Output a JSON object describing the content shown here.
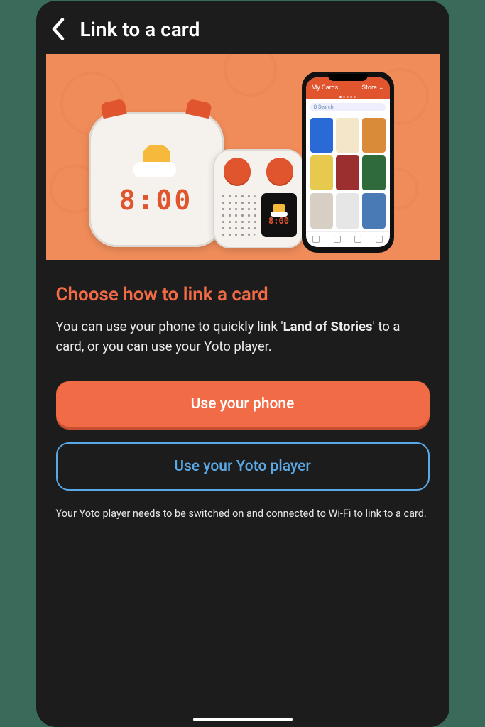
{
  "header": {
    "title": "Link to a card"
  },
  "hero": {
    "big_player_time": "8:00",
    "mini_player_time": "8:00",
    "phone_app": {
      "header_left": "My Cards",
      "header_right": "Store ⌄",
      "search_placeholder": "Q Search"
    }
  },
  "content": {
    "section_title": "Choose how to link a card",
    "description_pre": "You can use your phone to quickly link '",
    "description_item": "Land of Stories",
    "description_post": "' to a card, or you can use your Yoto player.",
    "primary_button": "Use your phone",
    "secondary_button": "Use your Yoto player",
    "footnote": "Your Yoto player needs to be switched on and connected to Wi-Fi to link to a card."
  }
}
